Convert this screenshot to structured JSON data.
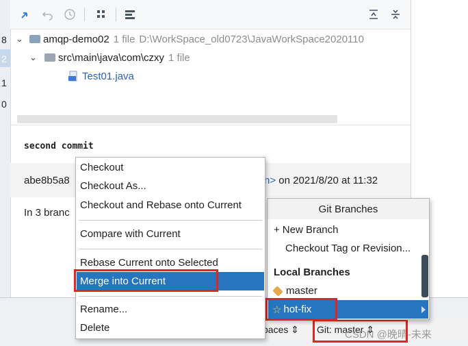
{
  "gutter": {
    "lines": [
      "8",
      "2",
      "1",
      "0"
    ]
  },
  "toolbar": {
    "icons": [
      "compare-icon",
      "undo-icon",
      "history-icon",
      "group-by-icon",
      "preview-icon",
      "expand-all-icon",
      "collapse-all-icon"
    ]
  },
  "tree": {
    "root": {
      "name": "amqp-demo02",
      "count": "1 file",
      "path": "D:\\WorkSpace_old0723\\JavaWorkSpace2020110"
    },
    "package": {
      "name": "src\\main\\java\\com\\czxy",
      "count": "1 file"
    },
    "file": {
      "name": "Test01.java"
    }
  },
  "commit": {
    "message": "second commit",
    "hash": "abe8b5a8",
    "author_suffix": "n>",
    "date": "on 2021/8/20 at 11:32",
    "branches": "In 3 branc"
  },
  "context_menu": {
    "items": [
      "Checkout",
      "Checkout As...",
      "Checkout and Rebase onto Current",
      "Compare with Current",
      "Rebase Current onto Selected",
      "Merge into Current",
      "Rename...",
      "Delete"
    ],
    "selected": "Merge into Current"
  },
  "branches_popup": {
    "title": "Git Branches",
    "new_branch": "New Branch",
    "checkout_tag": "Checkout Tag or Revision...",
    "local_header": "Local Branches",
    "local": [
      "master",
      "hot-fix"
    ],
    "selected": "hot-fix"
  },
  "statusbar": {
    "spaces": "paces",
    "git_branch": "Git: master",
    "watermark": "CSDN @晚晴-未来"
  },
  "colors": {
    "selection": "#2675bf",
    "highlight_box": "#e0261d",
    "tag": "#e3a94b"
  }
}
